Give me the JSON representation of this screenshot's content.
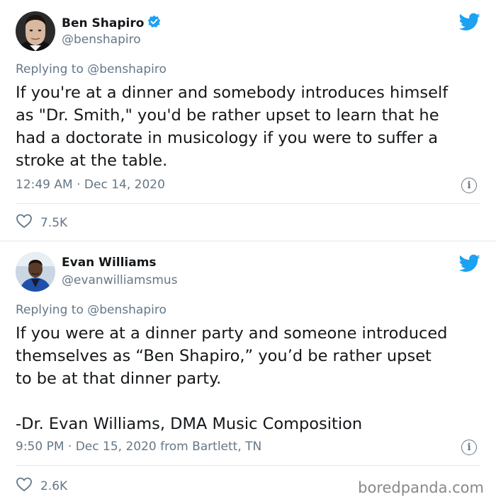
{
  "tweets": [
    {
      "name": "Ben Shapiro",
      "handle": "@benshapiro",
      "verified": true,
      "replying_to": "Replying to @benshapiro",
      "text": "If you're at a dinner and somebody introduces himself\nas \"Dr. Smith,\" you'd be rather upset to learn that he\nhad a doctorate in musicology if you were to suffer a\nstroke at the table.",
      "meta": "12:49 AM · Dec 14, 2020",
      "likes": "7.5K",
      "info_glyph": "i"
    },
    {
      "name": "Evan Williams",
      "handle": "@evanwilliamsmus",
      "verified": false,
      "replying_to": "Replying to @benshapiro",
      "text": "If you were at a dinner party and someone introduced\nthemselves as “Ben Shapiro,” you’d be rather upset\nto be at that dinner party.\n\n-Dr. Evan Williams, DMA Music Composition",
      "meta": "9:50 PM · Dec 15, 2020 from Bartlett, TN",
      "likes": "2.6K",
      "info_glyph": "i"
    }
  ],
  "watermark": "boredpanda.com",
  "colors": {
    "twitter_blue": "#1da1f2",
    "secondary_text": "#657786",
    "primary_text": "#14171a",
    "divider": "#e1e8ed"
  },
  "icons": [
    "twitter-bird-icon",
    "verified-badge-icon",
    "heart-icon",
    "info-icon"
  ]
}
